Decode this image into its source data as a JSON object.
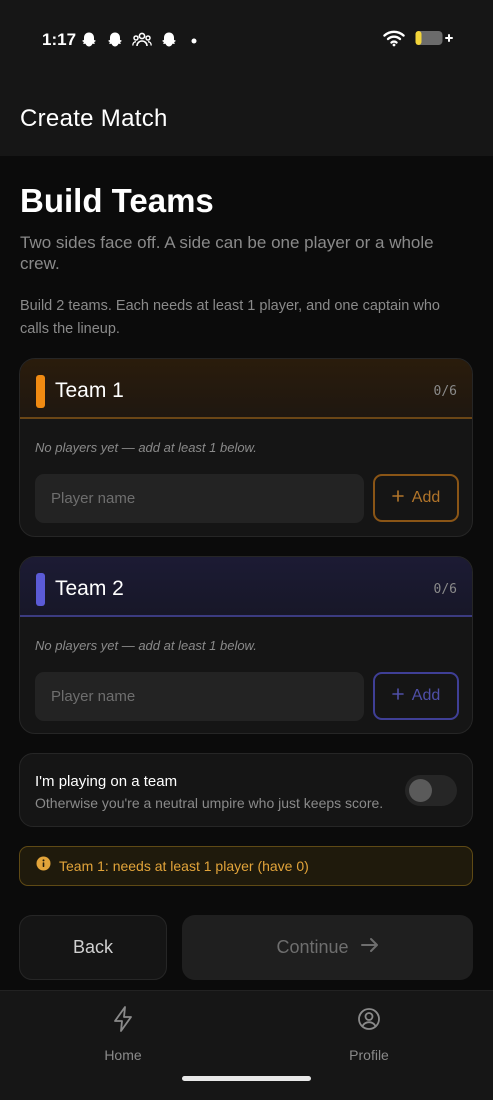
{
  "status_bar": {
    "time": "1:17",
    "icons": [
      "ghost-icon",
      "ghost-icon",
      "group-icon",
      "ghost-icon",
      "dot-icon"
    ],
    "right_icons": [
      "wifi-icon",
      "battery-charging-icon"
    ]
  },
  "header": {
    "title": "Create Match"
  },
  "page": {
    "title": "Build Teams",
    "subtitle": "Two sides face off. A side can be one player or a whole crew.",
    "hint": "Build 2 teams. Each needs at least 1 player, and one captain who calls the lineup."
  },
  "teams": [
    {
      "name": "Team 1",
      "count": "0/6",
      "empty_text": "No players yet — add at least 1 below.",
      "input_placeholder": "Player name",
      "add_label": "Add",
      "accent": "#f08a12"
    },
    {
      "name": "Team 2",
      "count": "0/6",
      "empty_text": "No players yet — add at least 1 below.",
      "input_placeholder": "Player name",
      "add_label": "Add",
      "accent": "#5b5bd6"
    }
  ],
  "playing_toggle": {
    "title": "I'm playing on a team",
    "description": "Otherwise you're a neutral umpire who just keeps score.",
    "on": false
  },
  "warning": {
    "text": "Team 1: needs at least 1 player (have 0)",
    "color": "#e2a43a"
  },
  "actions": {
    "back_label": "Back",
    "continue_label": "Continue"
  },
  "bottom_nav": {
    "home_label": "Home",
    "profile_label": "Profile"
  }
}
